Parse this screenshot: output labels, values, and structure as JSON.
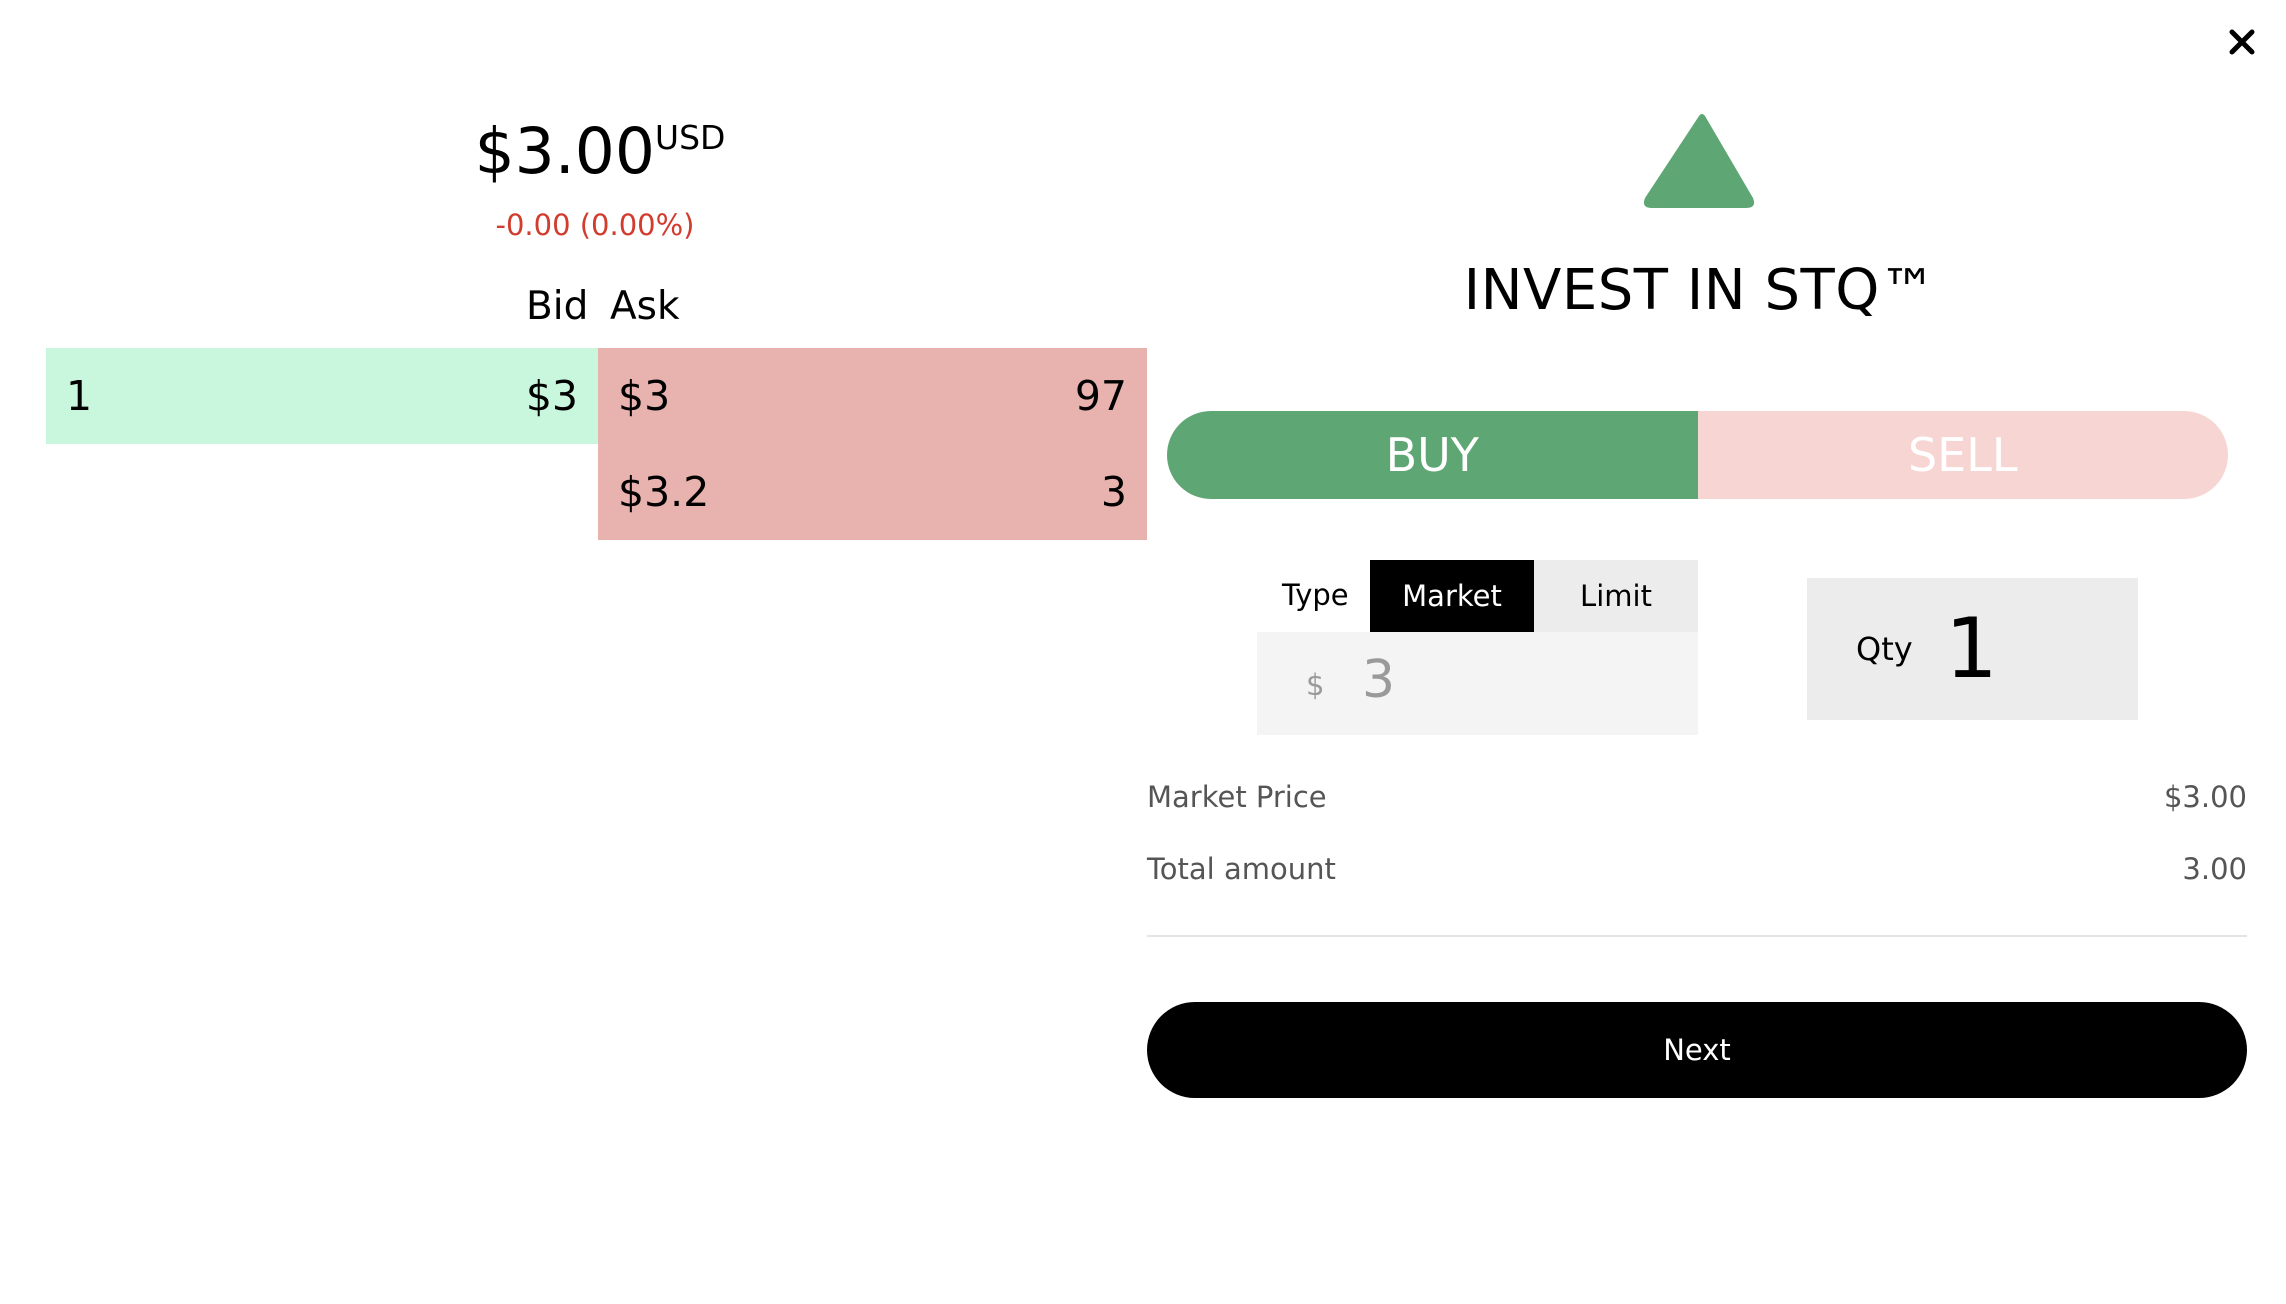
{
  "close_icon": "close-icon",
  "quote": {
    "price": "$3.00",
    "currency": "USD",
    "change": "-0.00 (0.00%)"
  },
  "order_book": {
    "bid_header": "Bid",
    "ask_header": "Ask",
    "bids": [
      {
        "qty": "1",
        "price": "$3"
      }
    ],
    "asks": [
      {
        "price": "$3",
        "qty": "97"
      },
      {
        "price": "$3.2",
        "qty": "3"
      }
    ]
  },
  "trade": {
    "logo_icon": "triangle-up-logo",
    "title": "INVEST IN STQ™",
    "buy_label": "BUY",
    "sell_label": "SELL",
    "selected_side": "BUY",
    "type_label": "Type",
    "market_label": "Market",
    "limit_label": "Limit",
    "selected_type": "Market",
    "price_symbol": "$",
    "price_value": "3",
    "qty_label": "Qty",
    "qty_value": "1",
    "market_price_label": "Market Price",
    "market_price_value": "$3.00",
    "total_label": "Total amount",
    "total_value": "3.00",
    "next_label": "Next"
  },
  "colors": {
    "buy": "#5ea674",
    "sell": "#f6d5d3",
    "bid_bg": "#c8f7dd",
    "ask_bg": "#e8b2ae",
    "negative": "#d23c2e"
  }
}
